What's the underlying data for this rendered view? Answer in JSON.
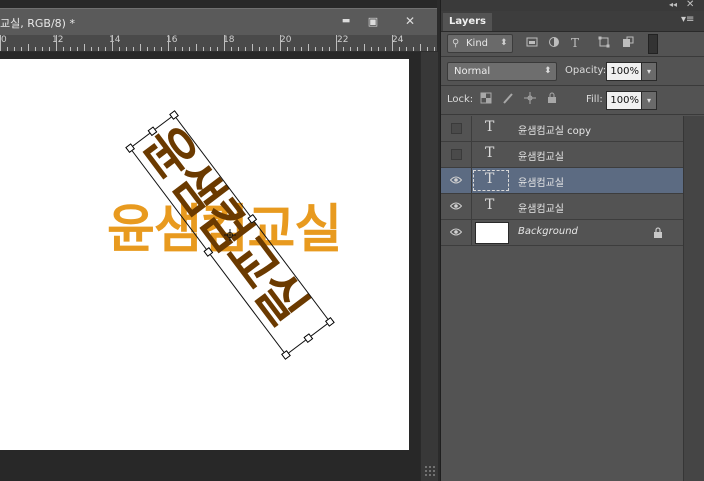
{
  "document": {
    "title": "교실, RGB/8) *",
    "ruler_labels": [
      "0",
      "12",
      "14",
      "16",
      "18",
      "20",
      "22",
      "24"
    ],
    "canvas_text": "윤샘컴교실",
    "rotated_text": "윤샘컴교실",
    "colors": {
      "orange_text": "#e89a1f",
      "rotated_text": "#6b3a00",
      "canvas": "#ffffff"
    }
  },
  "window_buttons": {
    "minimize": "▬",
    "maximize": "▣",
    "close": "✕"
  },
  "panel": {
    "collapse_glyph": "◂◂",
    "close_glyph": "✕",
    "menu_glyph": "▾≡",
    "tab_label": "Layers",
    "filter": {
      "kind_label": "Kind",
      "kind_search_glyph": "⚲",
      "kind_arrow": "⬍"
    },
    "blend_mode": "Normal",
    "blend_arrow": "⬍",
    "opacity_label": "Opacity:",
    "opacity_value": "100%",
    "lock_label": "Lock:",
    "fill_label": "Fill:",
    "fill_value": "100%",
    "dropdown_arrow": "▾",
    "layers": [
      {
        "name": "윤샘컴교실 copy",
        "type": "text",
        "visible": false,
        "selected": false
      },
      {
        "name": "윤샘컴교실",
        "type": "text",
        "visible": false,
        "selected": false
      },
      {
        "name": "윤샘컴교실",
        "type": "text",
        "visible": true,
        "selected": true
      },
      {
        "name": "윤샘컴교실",
        "type": "text",
        "visible": true,
        "selected": false
      },
      {
        "name": "Background",
        "type": "background",
        "visible": true,
        "selected": false,
        "locked": true
      }
    ],
    "thumb_text_glyph": "T",
    "icons": [
      "pixel-filter-icon",
      "adjustment-filter-icon",
      "type-filter-icon",
      "shape-filter-icon",
      "smart-object-filter-icon"
    ],
    "lock_icons": [
      "lock-transparent-icon",
      "lock-brush-icon",
      "lock-move-icon",
      "lock-all-icon"
    ]
  }
}
